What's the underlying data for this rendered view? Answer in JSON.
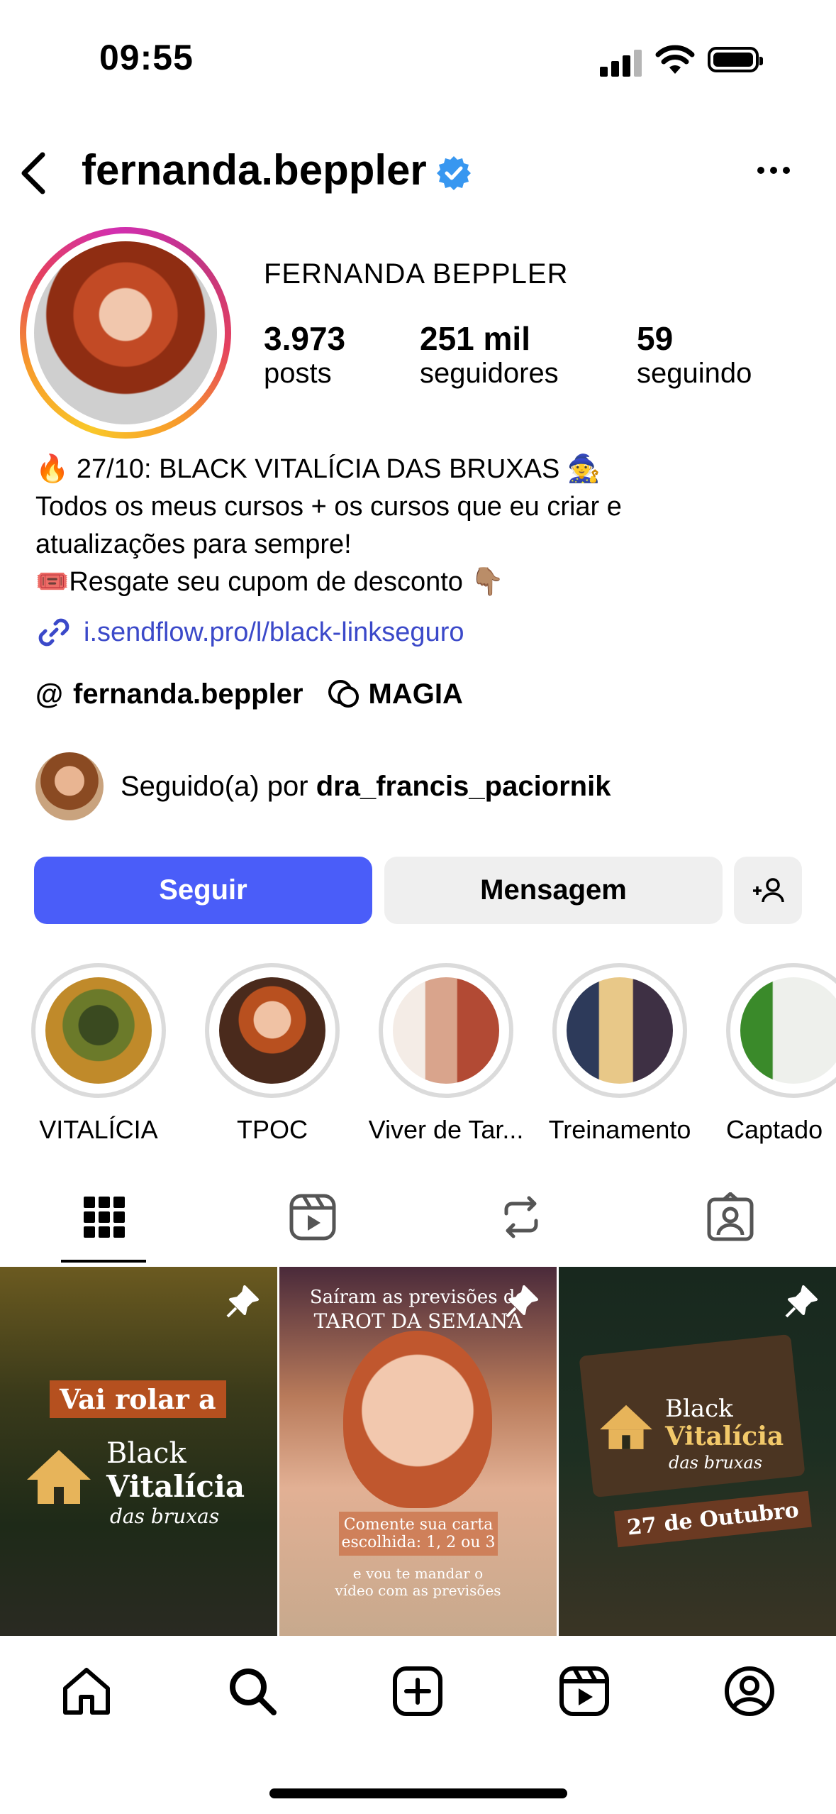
{
  "status_bar": {
    "time": "09:55"
  },
  "header": {
    "username": "fernanda.beppler"
  },
  "profile": {
    "full_name": "FERNANDA BEPPLER",
    "stats": [
      {
        "value": "3.973",
        "label": "posts"
      },
      {
        "value": "251 mil",
        "label": "seguidores"
      },
      {
        "value": "59",
        "label": "seguindo"
      }
    ],
    "bio": [
      "🔥 27/10: BLACK VITALÍCIA DAS BRUXAS 🧙",
      "Todos os meus cursos + os cursos que eu criar e",
      "atualizações para sempre!",
      "🎟️Resgate seu cupom de desconto 👇🏽"
    ],
    "link": "i.sendflow.pro/l/black-linkseguro",
    "threads_handle": "fernanda.beppler",
    "channel": "MAGIA",
    "followed_by_prefix": "Seguido(a) por ",
    "followed_by_user": "dra_francis_paciornik"
  },
  "actions": {
    "follow": "Seguir",
    "message": "Mensagem"
  },
  "highlights": [
    {
      "label": "VITALÍCIA"
    },
    {
      "label": "TPOC"
    },
    {
      "label": "Viver de Tar..."
    },
    {
      "label": "Treinamento"
    },
    {
      "label": "Captado"
    }
  ],
  "posts": [
    {
      "text_top": "Vai rolar a",
      "brand_1": "Black",
      "brand_2": "Vitalícia",
      "brand_3": "das bruxas"
    },
    {
      "text_top_1": "Saíram as previsões do",
      "text_top_2": "TAROT DA SEMANA",
      "caption_1": "Comente sua carta",
      "caption_2": "escolhida: 1, 2 ou 3",
      "caption_3": "e vou te mandar o",
      "caption_4": "vídeo com as previsões"
    },
    {
      "brand_1": "Black",
      "brand_2": "Vitalícia",
      "brand_3": "das bruxas",
      "date": "27 de Outubro"
    }
  ],
  "colors": {
    "follow_button": "#4a5df9",
    "link": "#3b49c9",
    "verified": "#3897f0"
  }
}
